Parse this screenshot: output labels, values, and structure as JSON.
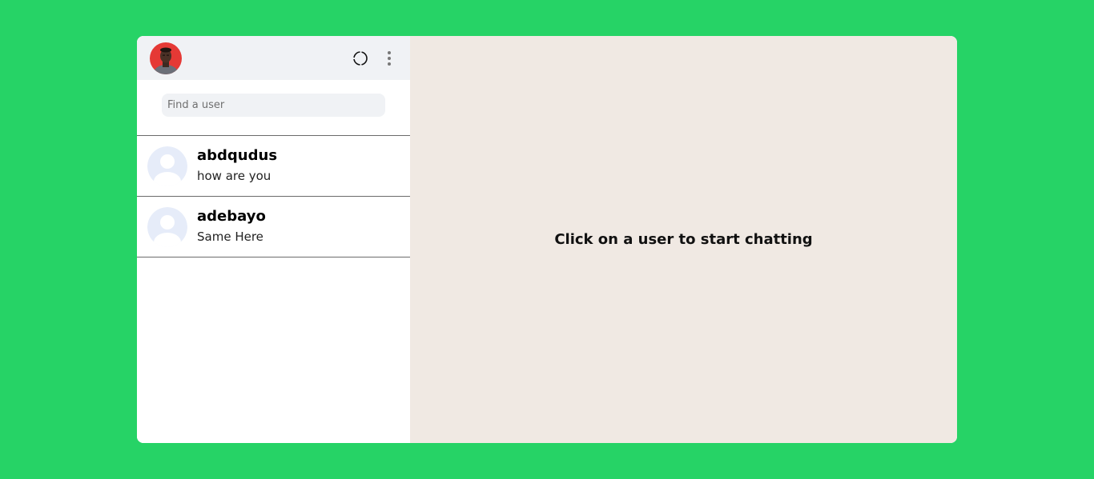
{
  "colors": {
    "page_background": "#26d366",
    "header_background": "#f0f2f5",
    "chat_background": "#f0e9e3",
    "default_avatar_bg": "#e6ecf9"
  },
  "sidebar": {
    "header": {
      "avatar_icon": "profile-photo",
      "status_icon": "status-circle-icon",
      "menu_icon": "vertical-dots-icon"
    },
    "search": {
      "placeholder": "Find a user",
      "value": ""
    },
    "chats": [
      {
        "name": "abdqudus",
        "last_message": "how are you"
      },
      {
        "name": "adebayo",
        "last_message": "Same Here"
      }
    ]
  },
  "main": {
    "empty_message": "Click on a user to start chatting"
  }
}
